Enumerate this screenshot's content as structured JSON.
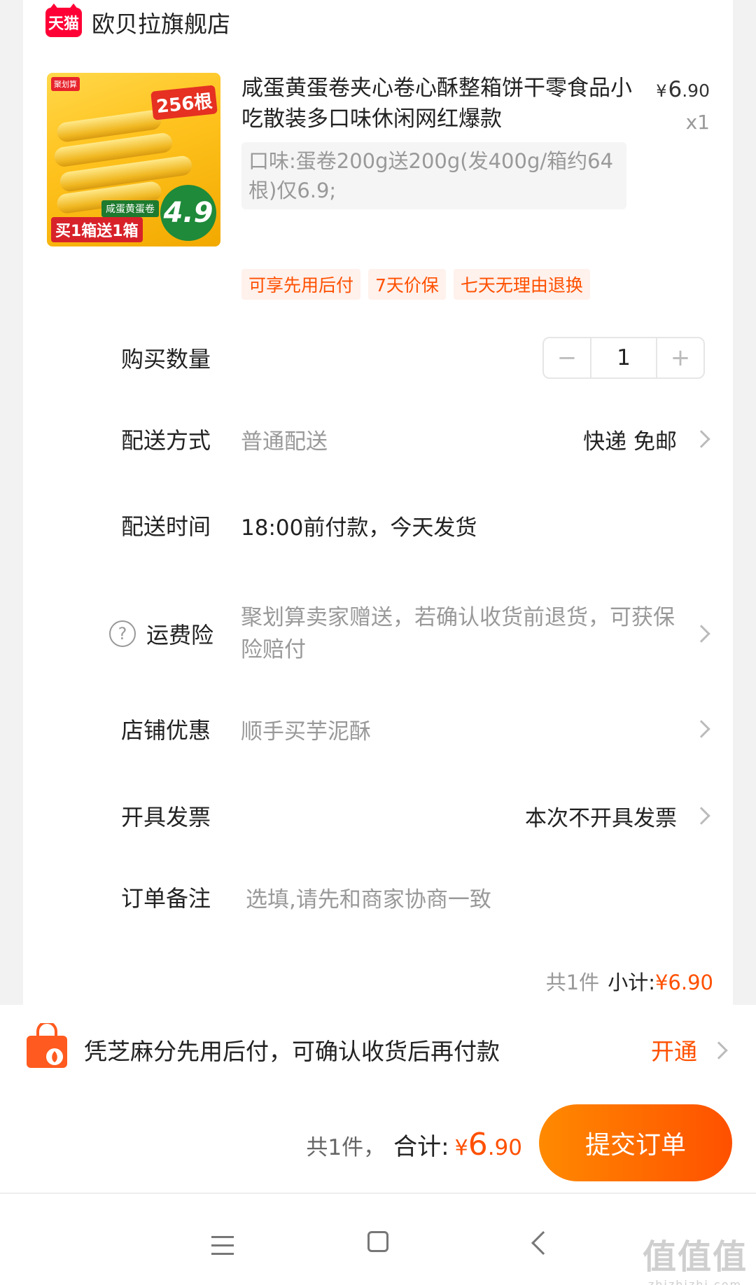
{
  "store": {
    "logo_text": "天猫",
    "name": "欧贝拉旗舰店"
  },
  "product": {
    "title": "咸蛋黄蛋卷夹心卷心酥整箱饼干零食品小吃散装多口味休闲网红爆款",
    "price_symbol": "¥",
    "price_int": "6",
    "price_dec": ".90",
    "quantity_label": "x1",
    "sku": "口味:蛋卷200g送200g(发400g/箱约64根)仅6.9;",
    "image": {
      "badge": "聚划算",
      "count": "256根",
      "banner": "买1箱送1箱",
      "sub": "咸蛋黄蛋卷",
      "price": "4.9"
    },
    "tags": [
      "可享先用后付",
      "7天价保",
      "七天无理由退换"
    ]
  },
  "quantity_row": {
    "label": "购买数量",
    "minus": "−",
    "value": "1",
    "plus": "+"
  },
  "delivery_method": {
    "label": "配送方式",
    "value": "普通配送",
    "right": "快递 免邮"
  },
  "delivery_time": {
    "label": "配送时间",
    "value": "18:00前付款，今天发货"
  },
  "insurance": {
    "icon": "?",
    "label": "运费险",
    "value": "聚划算卖家赠送，若确认收货前退货，可获保险赔付"
  },
  "store_discount": {
    "label": "店铺优惠",
    "value": "顺手买芋泥酥"
  },
  "invoice": {
    "label": "开具发票",
    "right": "本次不开具发票"
  },
  "note": {
    "label": "订单备注",
    "placeholder": "选填,请先和商家协商一致"
  },
  "subtotal": {
    "count": "共1件",
    "label": "小计:",
    "amount": "¥6.90"
  },
  "credit": {
    "text": "凭芝麻分先用后付，可确认收货后再付款",
    "action": "开通"
  },
  "footer": {
    "count": "共1件，",
    "total_label": "合计:",
    "yen": "¥",
    "total_int": "6",
    "total_dec": ".90",
    "submit": "提交订单"
  },
  "watermark": {
    "big": "值值值",
    "small": "zhizhizhi.com"
  },
  "colors": {
    "accent": "#ff5000",
    "tmall_red": "#ff0036"
  }
}
